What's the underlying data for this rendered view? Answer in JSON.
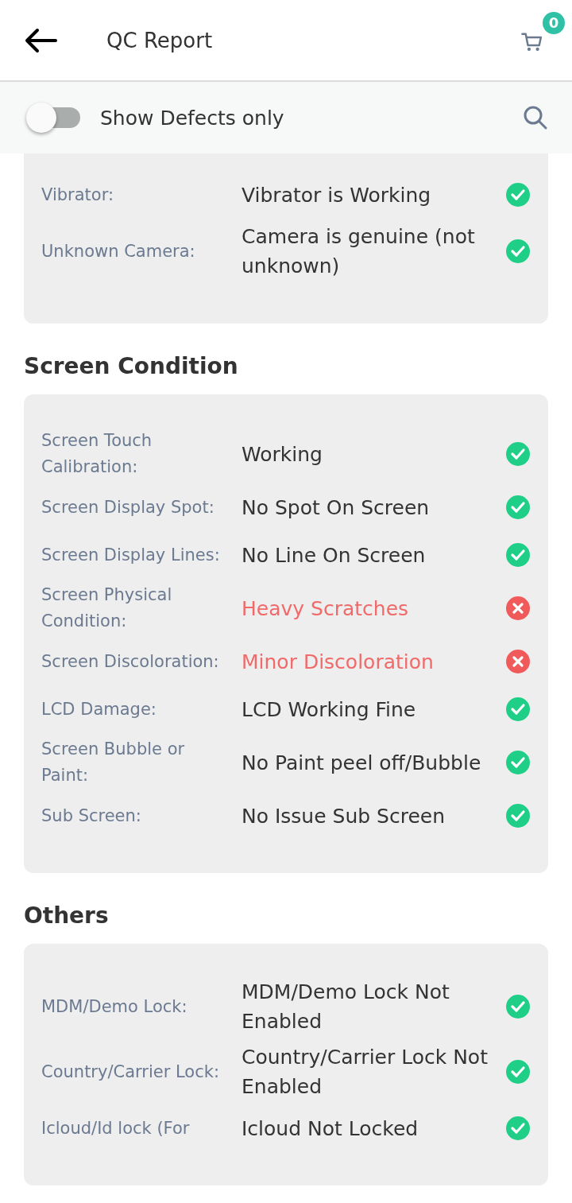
{
  "header": {
    "title": "QC Report",
    "cart_count": "0"
  },
  "filter": {
    "label": "Show Defects only",
    "on": false
  },
  "sections": [
    {
      "rows": [
        {
          "label": "Vibrator:",
          "value": "Vibrator is Working",
          "defect": false
        },
        {
          "label": "Unknown Camera:",
          "value": "Camera is genuine (not unknown)",
          "defect": false
        }
      ]
    },
    {
      "title": "Screen Condition",
      "rows": [
        {
          "label": "Screen Touch Calibration:",
          "value": "Working",
          "defect": false
        },
        {
          "label": "Screen Display Spot:",
          "value": "No Spot On Screen",
          "defect": false
        },
        {
          "label": "Screen Display Lines:",
          "value": "No Line On Screen",
          "defect": false
        },
        {
          "label": "Screen Physical Condition:",
          "value": "Heavy Scratches",
          "defect": true
        },
        {
          "label": "Screen Discoloration:",
          "value": "Minor Discoloration",
          "defect": true
        },
        {
          "label": "LCD Damage:",
          "value": "LCD Working Fine",
          "defect": false
        },
        {
          "label": "Screen Bubble or Paint:",
          "value": "No Paint peel off/Bubble",
          "defect": false
        },
        {
          "label": "Sub Screen:",
          "value": "No Issue Sub Screen",
          "defect": false
        }
      ]
    },
    {
      "title": "Others",
      "rows": [
        {
          "label": "MDM/Demo Lock:",
          "value": "MDM/Demo Lock Not Enabled",
          "defect": false
        },
        {
          "label": "Country/Carrier Lock:",
          "value": "Country/Carrier Lock Not Enabled",
          "defect": false
        },
        {
          "label": "Icloud/Id lock (For",
          "value": "Icloud Not Locked",
          "defect": false
        }
      ]
    }
  ]
}
